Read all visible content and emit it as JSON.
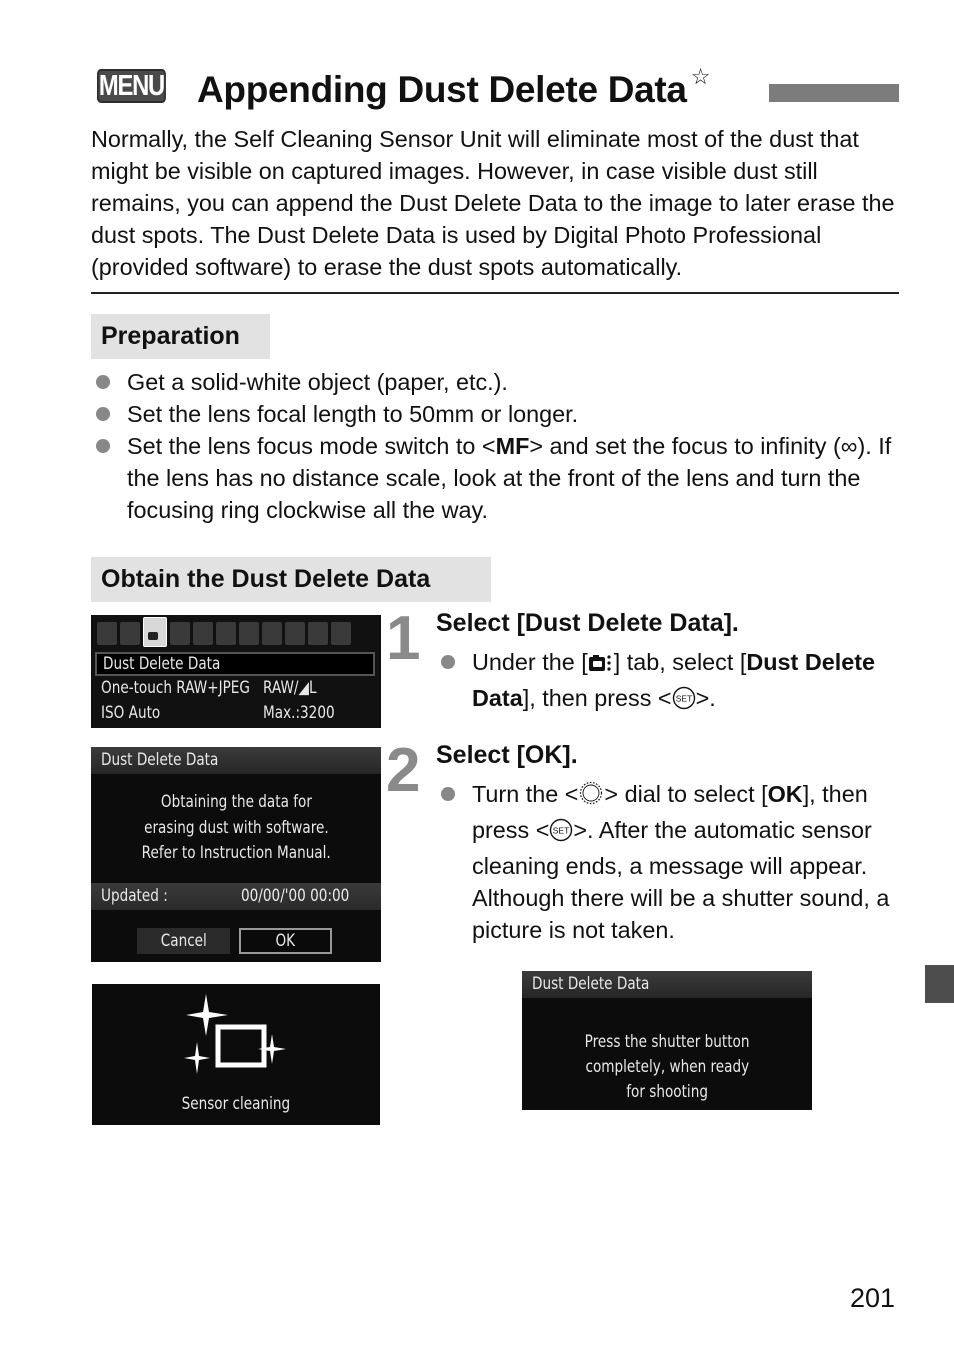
{
  "header": {
    "menu_badge": "MENU",
    "title": "Appending Dust Delete Data",
    "title_star": "☆"
  },
  "intro": "Normally, the Self Cleaning Sensor Unit will eliminate most of the dust that might be visible on captured images. However, in case visible dust still remains, you can append the Dust Delete Data to the image to later erase the dust spots. The Dust Delete Data is used by Digital Photo Professional (provided software) to erase the dust spots automatically.",
  "preparation": {
    "heading": "Preparation",
    "items": [
      {
        "text": "Get a solid-white object (paper, etc.)."
      },
      {
        "text": "Set the lens focal length to 50mm or longer."
      },
      {
        "pre": "Set the lens focus mode switch to <",
        "bold": "MF",
        "post": "> and set the focus to infinity (∞). If the lens has no distance scale, look at the front of the lens and turn the focusing ring clockwise all the way."
      }
    ]
  },
  "obtain": {
    "heading": "Obtain the Dust Delete Data"
  },
  "steps": [
    {
      "number": "1",
      "title": "Select [Dust Delete Data].",
      "bullet": {
        "part1": "Under the [",
        "part2": "] tab, select [",
        "bold1": "Dust Delete Data",
        "part3": "], then press <",
        "part4": ">."
      }
    },
    {
      "number": "2",
      "title": "Select [OK].",
      "bullet": {
        "part1": "Turn the <",
        "part2": "> dial to select [",
        "bold1": "OK",
        "part3": "], then press <",
        "part4": ">. After the automatic sensor cleaning ends, a message will appear. Although there will be a shutter sound, a picture is not taken."
      }
    }
  ],
  "screens": {
    "menu": {
      "rows": [
        {
          "label": "Dust Delete Data",
          "value": ""
        },
        {
          "label": "One-touch RAW+JPEG",
          "value": "RAW/◢L"
        },
        {
          "label": "ISO Auto",
          "value": "Max.:3200"
        }
      ]
    },
    "confirm": {
      "header": "Dust Delete Data",
      "message": [
        "Obtaining the data for",
        "erasing dust with software.",
        "Refer to Instruction Manual."
      ],
      "updated_label": "Updated :",
      "updated_value": "00/00/'00 00:00",
      "cancel": "Cancel",
      "ok": "OK"
    },
    "cleaning": {
      "caption": "Sensor cleaning"
    },
    "shutter": {
      "header": "Dust Delete Data",
      "message": [
        "Press the shutter button",
        "completely, when ready",
        "for shooting"
      ]
    }
  },
  "icons": {
    "set_button": "SET",
    "dial": "quick-control-dial-icon",
    "shooting_tab": "camera-shooting-tab-icon"
  },
  "page_number": "201"
}
